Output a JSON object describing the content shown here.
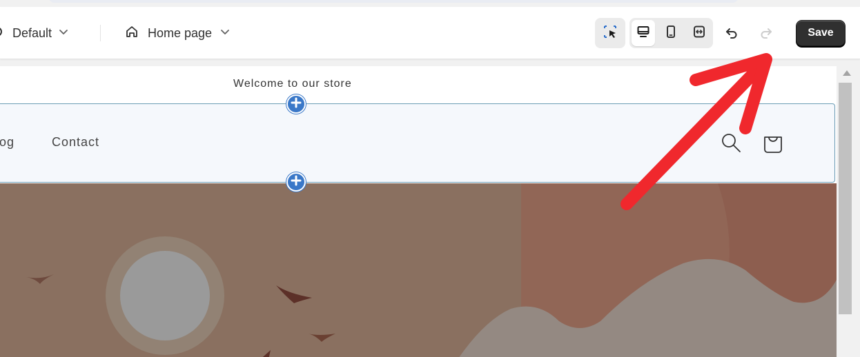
{
  "toolbar": {
    "theme_label": "Default",
    "page_label": "Home page",
    "save_label": "Save",
    "icons": {
      "theme": "theme-icon",
      "page": "home-icon",
      "inspect": "select-element-icon",
      "desktop": "desktop-icon",
      "mobile": "mobile-icon",
      "fullwidth": "fullscreen-icon",
      "undo": "undo-icon",
      "redo": "redo-icon"
    }
  },
  "preview": {
    "announcement": "Welcome to our store",
    "nav": [
      "talog",
      "Contact"
    ],
    "header_icons": [
      "search-icon",
      "cart-icon"
    ]
  },
  "colors": {
    "save_bg": "#303030",
    "accent_blue": "#3a78c8",
    "hero_brown": "#8b6e5e",
    "annotation_red": "#f0282d"
  }
}
